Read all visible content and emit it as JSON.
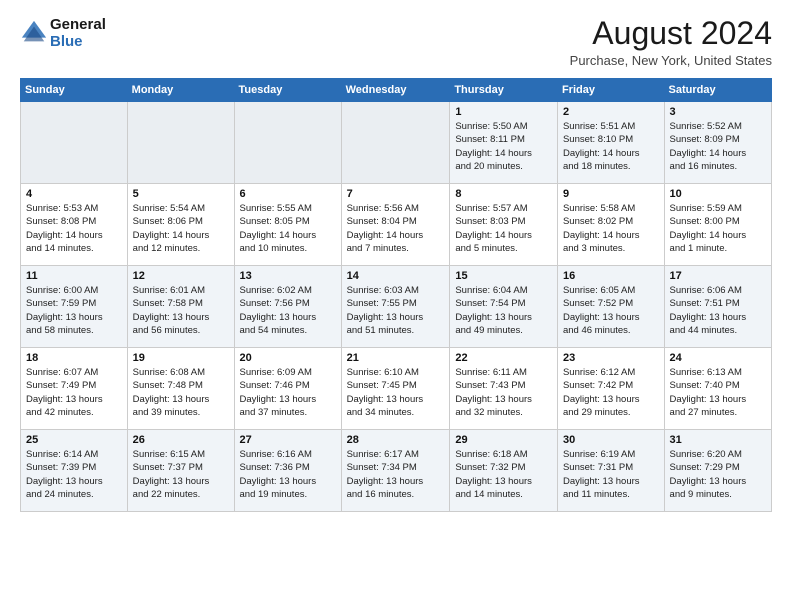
{
  "header": {
    "logo_line1": "General",
    "logo_line2": "Blue",
    "month": "August 2024",
    "location": "Purchase, New York, United States"
  },
  "weekdays": [
    "Sunday",
    "Monday",
    "Tuesday",
    "Wednesday",
    "Thursday",
    "Friday",
    "Saturday"
  ],
  "weeks": [
    [
      {
        "day": "",
        "info": ""
      },
      {
        "day": "",
        "info": ""
      },
      {
        "day": "",
        "info": ""
      },
      {
        "day": "",
        "info": ""
      },
      {
        "day": "1",
        "info": "Sunrise: 5:50 AM\nSunset: 8:11 PM\nDaylight: 14 hours\nand 20 minutes."
      },
      {
        "day": "2",
        "info": "Sunrise: 5:51 AM\nSunset: 8:10 PM\nDaylight: 14 hours\nand 18 minutes."
      },
      {
        "day": "3",
        "info": "Sunrise: 5:52 AM\nSunset: 8:09 PM\nDaylight: 14 hours\nand 16 minutes."
      }
    ],
    [
      {
        "day": "4",
        "info": "Sunrise: 5:53 AM\nSunset: 8:08 PM\nDaylight: 14 hours\nand 14 minutes."
      },
      {
        "day": "5",
        "info": "Sunrise: 5:54 AM\nSunset: 8:06 PM\nDaylight: 14 hours\nand 12 minutes."
      },
      {
        "day": "6",
        "info": "Sunrise: 5:55 AM\nSunset: 8:05 PM\nDaylight: 14 hours\nand 10 minutes."
      },
      {
        "day": "7",
        "info": "Sunrise: 5:56 AM\nSunset: 8:04 PM\nDaylight: 14 hours\nand 7 minutes."
      },
      {
        "day": "8",
        "info": "Sunrise: 5:57 AM\nSunset: 8:03 PM\nDaylight: 14 hours\nand 5 minutes."
      },
      {
        "day": "9",
        "info": "Sunrise: 5:58 AM\nSunset: 8:02 PM\nDaylight: 14 hours\nand 3 minutes."
      },
      {
        "day": "10",
        "info": "Sunrise: 5:59 AM\nSunset: 8:00 PM\nDaylight: 14 hours\nand 1 minute."
      }
    ],
    [
      {
        "day": "11",
        "info": "Sunrise: 6:00 AM\nSunset: 7:59 PM\nDaylight: 13 hours\nand 58 minutes."
      },
      {
        "day": "12",
        "info": "Sunrise: 6:01 AM\nSunset: 7:58 PM\nDaylight: 13 hours\nand 56 minutes."
      },
      {
        "day": "13",
        "info": "Sunrise: 6:02 AM\nSunset: 7:56 PM\nDaylight: 13 hours\nand 54 minutes."
      },
      {
        "day": "14",
        "info": "Sunrise: 6:03 AM\nSunset: 7:55 PM\nDaylight: 13 hours\nand 51 minutes."
      },
      {
        "day": "15",
        "info": "Sunrise: 6:04 AM\nSunset: 7:54 PM\nDaylight: 13 hours\nand 49 minutes."
      },
      {
        "day": "16",
        "info": "Sunrise: 6:05 AM\nSunset: 7:52 PM\nDaylight: 13 hours\nand 46 minutes."
      },
      {
        "day": "17",
        "info": "Sunrise: 6:06 AM\nSunset: 7:51 PM\nDaylight: 13 hours\nand 44 minutes."
      }
    ],
    [
      {
        "day": "18",
        "info": "Sunrise: 6:07 AM\nSunset: 7:49 PM\nDaylight: 13 hours\nand 42 minutes."
      },
      {
        "day": "19",
        "info": "Sunrise: 6:08 AM\nSunset: 7:48 PM\nDaylight: 13 hours\nand 39 minutes."
      },
      {
        "day": "20",
        "info": "Sunrise: 6:09 AM\nSunset: 7:46 PM\nDaylight: 13 hours\nand 37 minutes."
      },
      {
        "day": "21",
        "info": "Sunrise: 6:10 AM\nSunset: 7:45 PM\nDaylight: 13 hours\nand 34 minutes."
      },
      {
        "day": "22",
        "info": "Sunrise: 6:11 AM\nSunset: 7:43 PM\nDaylight: 13 hours\nand 32 minutes."
      },
      {
        "day": "23",
        "info": "Sunrise: 6:12 AM\nSunset: 7:42 PM\nDaylight: 13 hours\nand 29 minutes."
      },
      {
        "day": "24",
        "info": "Sunrise: 6:13 AM\nSunset: 7:40 PM\nDaylight: 13 hours\nand 27 minutes."
      }
    ],
    [
      {
        "day": "25",
        "info": "Sunrise: 6:14 AM\nSunset: 7:39 PM\nDaylight: 13 hours\nand 24 minutes."
      },
      {
        "day": "26",
        "info": "Sunrise: 6:15 AM\nSunset: 7:37 PM\nDaylight: 13 hours\nand 22 minutes."
      },
      {
        "day": "27",
        "info": "Sunrise: 6:16 AM\nSunset: 7:36 PM\nDaylight: 13 hours\nand 19 minutes."
      },
      {
        "day": "28",
        "info": "Sunrise: 6:17 AM\nSunset: 7:34 PM\nDaylight: 13 hours\nand 16 minutes."
      },
      {
        "day": "29",
        "info": "Sunrise: 6:18 AM\nSunset: 7:32 PM\nDaylight: 13 hours\nand 14 minutes."
      },
      {
        "day": "30",
        "info": "Sunrise: 6:19 AM\nSunset: 7:31 PM\nDaylight: 13 hours\nand 11 minutes."
      },
      {
        "day": "31",
        "info": "Sunrise: 6:20 AM\nSunset: 7:29 PM\nDaylight: 13 hours\nand 9 minutes."
      }
    ]
  ]
}
